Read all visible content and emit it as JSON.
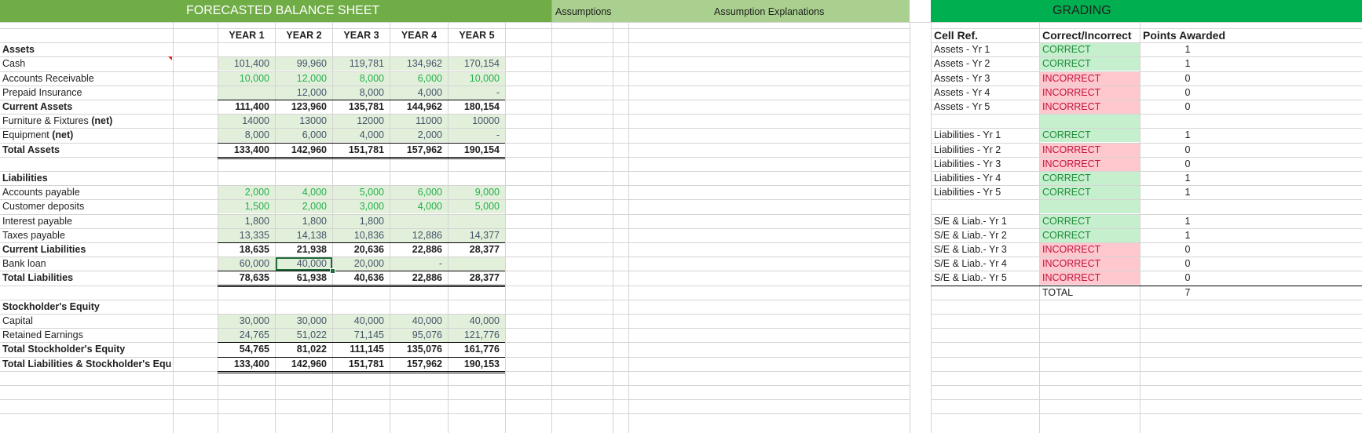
{
  "banner": {
    "balance_sheet_title": "FORECASTED BALANCE SHEET",
    "assumptions": "Assumptions",
    "assumption_explanations": "Assumption Explanations",
    "grading": "GRADING"
  },
  "columns": [
    "YEAR 1",
    "YEAR 2",
    "YEAR 3",
    "YEAR 4",
    "YEAR 5"
  ],
  "balance_rows": [
    {
      "label": "Assets",
      "bold": true,
      "section": true,
      "values": []
    },
    {
      "label": "Cash",
      "values": [
        "101,400",
        "99,960",
        "119,781",
        "134,962",
        "170,154"
      ],
      "color": "navy",
      "fill": true
    },
    {
      "label": "Accounts Receivable",
      "values": [
        "10,000",
        "12,000",
        "8,000",
        "6,000",
        "10,000"
      ],
      "color": "green",
      "fill": true
    },
    {
      "label": "Prepaid Insurance",
      "values": [
        "",
        "12,000",
        "8,000",
        "4,000",
        "-"
      ],
      "color": "navy",
      "fill": true
    },
    {
      "label": "Current Assets",
      "bold": true,
      "values": [
        "111,400",
        "123,960",
        "135,781",
        "144,962",
        "180,154"
      ],
      "line": "top"
    },
    {
      "label": "Furniture & Fixtures",
      "label_suffix": "(net)",
      "values": [
        "14000",
        "13000",
        "12000",
        "11000",
        "10000"
      ],
      "color": "navy",
      "fill": true
    },
    {
      "label": "Equipment",
      "label_suffix": "(net)",
      "values": [
        "8,000",
        "6,000",
        "4,000",
        "2,000",
        "-"
      ],
      "color": "navy",
      "fill": true
    },
    {
      "label": "Total Assets",
      "bold": true,
      "values": [
        "133,400",
        "142,960",
        "151,781",
        "157,962",
        "190,154"
      ],
      "line": "total"
    },
    {
      "label": "",
      "values": []
    },
    {
      "label": "Liabilities",
      "bold": true,
      "values": []
    },
    {
      "label": "Accounts payable",
      "values": [
        "2,000",
        "4,000",
        "5,000",
        "6,000",
        "9,000"
      ],
      "color": "green",
      "fill": true
    },
    {
      "label": "Customer deposits",
      "values": [
        "1,500",
        "2,000",
        "3,000",
        "4,000",
        "5,000"
      ],
      "color": "green",
      "fill": true
    },
    {
      "label": "Interest payable",
      "values": [
        "1,800",
        "1,800",
        "1,800",
        "",
        ""
      ],
      "color": "navy",
      "fill": true
    },
    {
      "label": "Taxes payable",
      "values": [
        "13,335",
        "14,138",
        "10,836",
        "12,886",
        "14,377"
      ],
      "color": "navy",
      "fill": true
    },
    {
      "label": "Current Liabilities",
      "bold": true,
      "boldvals": false,
      "values": [
        "18,635",
        "21,938",
        "20,636",
        "22,886",
        "28,377"
      ],
      "line": "top"
    },
    {
      "label": "Bank loan",
      "values": [
        "60,000",
        "40,000",
        "20,000",
        "-",
        ""
      ],
      "color": "navy",
      "fill": true
    },
    {
      "label": "Total Liabilities",
      "bold": true,
      "values": [
        "78,635",
        "61,938",
        "40,636",
        "22,886",
        "28,377"
      ],
      "line": "total"
    },
    {
      "label": "",
      "values": []
    },
    {
      "label": "Stockholder's Equity",
      "bold": true,
      "values": []
    },
    {
      "label": "Capital",
      "values": [
        "30,000",
        "30,000",
        "40,000",
        "40,000",
        "40,000"
      ],
      "color": "navy",
      "fill": true
    },
    {
      "label": "Retained Earnings",
      "values": [
        "24,765",
        "51,022",
        "71,145",
        "95,076",
        "121,776"
      ],
      "color": "navy",
      "fill": true
    },
    {
      "label": "Total Stockholder's Equity",
      "bold": true,
      "boldvals": false,
      "values": [
        "54,765",
        "81,022",
        "111,145",
        "135,076",
        "161,776"
      ],
      "line": "top"
    },
    {
      "label": "Total Liabilities & Stockholder's Equity",
      "bold": true,
      "values": [
        "133,400",
        "142,960",
        "151,781",
        "157,962",
        "190,153"
      ],
      "line": "total"
    }
  ],
  "grading": {
    "headers": {
      "cell_ref": "Cell Ref.",
      "correct": "Correct/Incorrect",
      "points": "Points Awarded"
    },
    "rows": [
      {
        "ref": "Assets - Yr 1",
        "result": "CORRECT",
        "points": "1"
      },
      {
        "ref": "Assets - Yr 2",
        "result": "CORRECT",
        "points": "1"
      },
      {
        "ref": "Assets - Yr 3",
        "result": "INCORRECT",
        "points": "0"
      },
      {
        "ref": "Assets - Yr 4",
        "result": "INCORRECT",
        "points": "0"
      },
      {
        "ref": "Assets - Yr 5",
        "result": "INCORRECT",
        "points": "0"
      },
      {
        "ref": "",
        "result": "",
        "points": "",
        "fillcorrect": true
      },
      {
        "ref": "Liabilities - Yr 1",
        "result": "CORRECT",
        "points": "1"
      },
      {
        "ref": "Liabilities - Yr 2",
        "result": "INCORRECT",
        "points": "0"
      },
      {
        "ref": "Liabilities - Yr 3",
        "result": "INCORRECT",
        "points": "0"
      },
      {
        "ref": "Liabilities - Yr 4",
        "result": "CORRECT",
        "points": "1"
      },
      {
        "ref": "Liabilities - Yr 5",
        "result": "CORRECT",
        "points": "1"
      },
      {
        "ref": "",
        "result": "",
        "points": "",
        "fillcorrect": true
      },
      {
        "ref": "S/E & Liab.- Yr 1",
        "result": "CORRECT",
        "points": "1"
      },
      {
        "ref": "S/E & Liab.- Yr 2",
        "result": "CORRECT",
        "points": "1"
      },
      {
        "ref": "S/E & Liab.- Yr 3",
        "result": "INCORRECT",
        "points": "0"
      },
      {
        "ref": "S/E & Liab.- Yr 4",
        "result": "INCORRECT",
        "points": "0"
      },
      {
        "ref": "S/E & Liab.- Yr 5",
        "result": "INCORRECT",
        "points": "0"
      }
    ],
    "total_label": "TOTAL",
    "total_points": "7"
  },
  "colors": {
    "banner_green": "#70ad47",
    "banner_light": "#a9d08e",
    "grading_green": "#00b050",
    "cell_fill_green": "#e2efda",
    "correct_fill": "#c6efce",
    "incorrect_fill": "#ffc7ce",
    "grid": "#d4d4d4"
  }
}
